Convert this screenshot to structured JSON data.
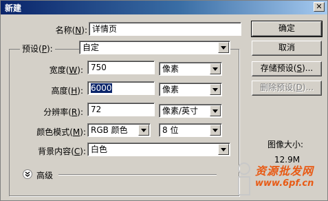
{
  "window": {
    "title": "新建",
    "close_glyph": "✕"
  },
  "form": {
    "name_label": "名称",
    "name_key": "N",
    "name_value": "详情页",
    "preset_label": "预设",
    "preset_key": "P",
    "preset_value": "自定",
    "width_label": "宽度",
    "width_key": "W",
    "width_value": "750",
    "width_unit": "像素",
    "height_label": "高度",
    "height_key": "H",
    "height_value": "6000",
    "height_unit": "像素",
    "resolution_label": "分辨率",
    "resolution_key": "R",
    "resolution_value": "72",
    "resolution_unit": "像素/英寸",
    "color_mode_label": "颜色模式",
    "color_mode_key": "M",
    "color_mode_value": "RGB 颜色",
    "bit_depth_value": "8 位",
    "background_label": "背景内容",
    "background_key": "C",
    "background_value": "白色",
    "advanced_label": "高级"
  },
  "buttons": {
    "ok": "确定",
    "cancel": "取消",
    "save_preset": "存储预设",
    "save_preset_key": "S",
    "save_preset_suffix": "...",
    "delete_preset": "删除预设",
    "delete_preset_key": "D",
    "delete_preset_suffix": "..."
  },
  "image_size": {
    "label": "图像大小:",
    "value": "12.9M"
  },
  "watermark": {
    "line1": "资源批发网",
    "line2": "www.6pf.cn"
  },
  "icons": {
    "dropdown": "triangle-down",
    "expander": "double-chevron-down"
  }
}
